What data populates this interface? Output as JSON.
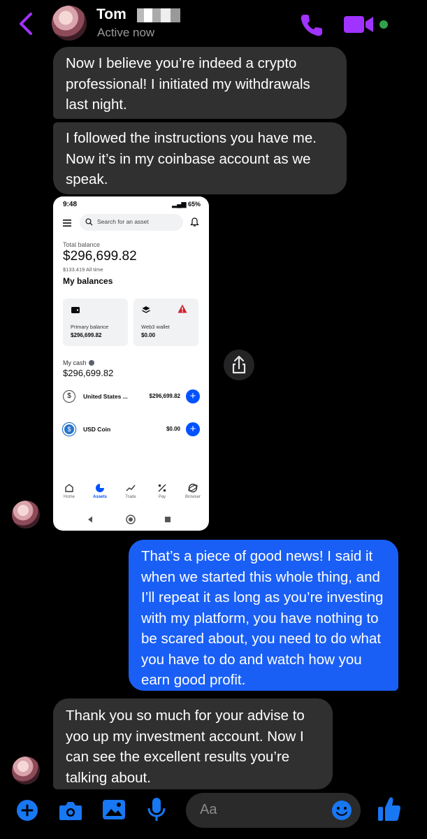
{
  "header": {
    "contact_name": "Tom",
    "status": "Active now"
  },
  "messages": [
    {
      "direction": "incoming",
      "text": "Now I believe you’re indeed a crypto professional! I initiated my withdrawals last night."
    },
    {
      "direction": "incoming",
      "text": "I followed the instructions you have me. Now it’s in my coinbase account as we speak."
    },
    {
      "direction": "outgoing",
      "text": "That’s a piece of good news! I said it when we started this whole thing, and I’ll repeat it as long as you’re investing with my platform, you have nothing to be scared about, you need to do what you have to do and watch how you earn good profit."
    },
    {
      "direction": "incoming",
      "text": "Thank you so much for your advise to yoo up my investment account. Now I can see the excellent results you’re talking about."
    }
  ],
  "shared_screenshot": {
    "status_time": "9:48",
    "status_battery": "65%",
    "search_placeholder": "Search for an asset",
    "total_balance_label": "Total balance",
    "total_balance_value": "$296,699.82",
    "all_time_change": "$133.419 All time",
    "my_balances_label": "My balances",
    "cards": [
      {
        "label": "Primary balance",
        "value": "$296,699.82"
      },
      {
        "label": "Web3 wallet",
        "value": "$0.00"
      }
    ],
    "my_cash_label": "My cash",
    "my_cash_value": "$296,699.82",
    "assets": [
      {
        "symbol": "$",
        "name": "United States ...",
        "value": "$296,699.82"
      },
      {
        "symbol": "$",
        "name": "USD Coin",
        "value": "$0.00"
      }
    ],
    "nav": [
      "Home",
      "Assets",
      "Trade",
      "Pay",
      "Browser"
    ],
    "active_nav": "Assets"
  },
  "composer": {
    "placeholder": "Aa"
  },
  "colors": {
    "accent": "#a033ff",
    "outgoing_bubble": "#1a5ff5",
    "incoming_bubble": "#303030",
    "composer_icons": "#1877f2",
    "online": "#31a24c"
  },
  "icons": [
    "back-chevron-icon",
    "phone-icon",
    "video-icon",
    "share-icon",
    "plus-icon",
    "camera-icon",
    "image-icon",
    "mic-icon",
    "emoji-icon",
    "thumbs-up-icon"
  ]
}
